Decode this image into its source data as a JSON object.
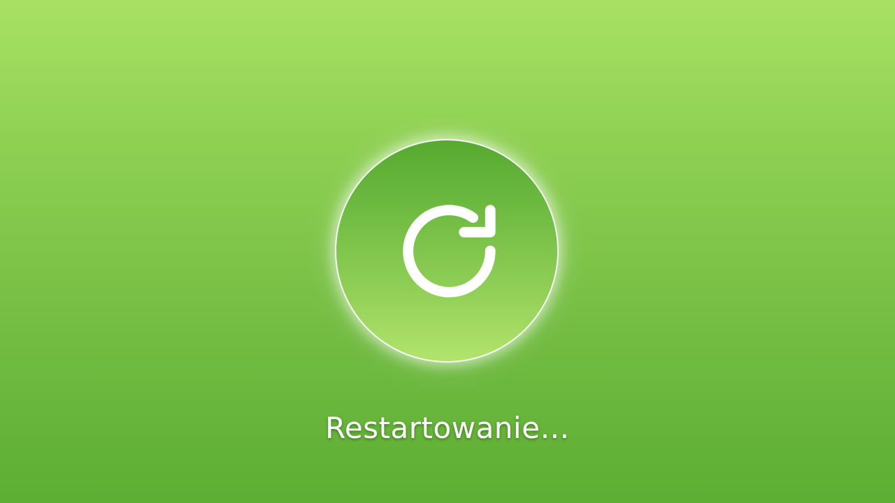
{
  "screen": {
    "status_text": "Restartowanie…",
    "icon": "restart-icon",
    "colors": {
      "background_top": "#a8e163",
      "background_bottom": "#5cae33",
      "circle_top": "#56a92f",
      "circle_bottom": "#b2e46c",
      "foreground": "#ffffff"
    }
  }
}
